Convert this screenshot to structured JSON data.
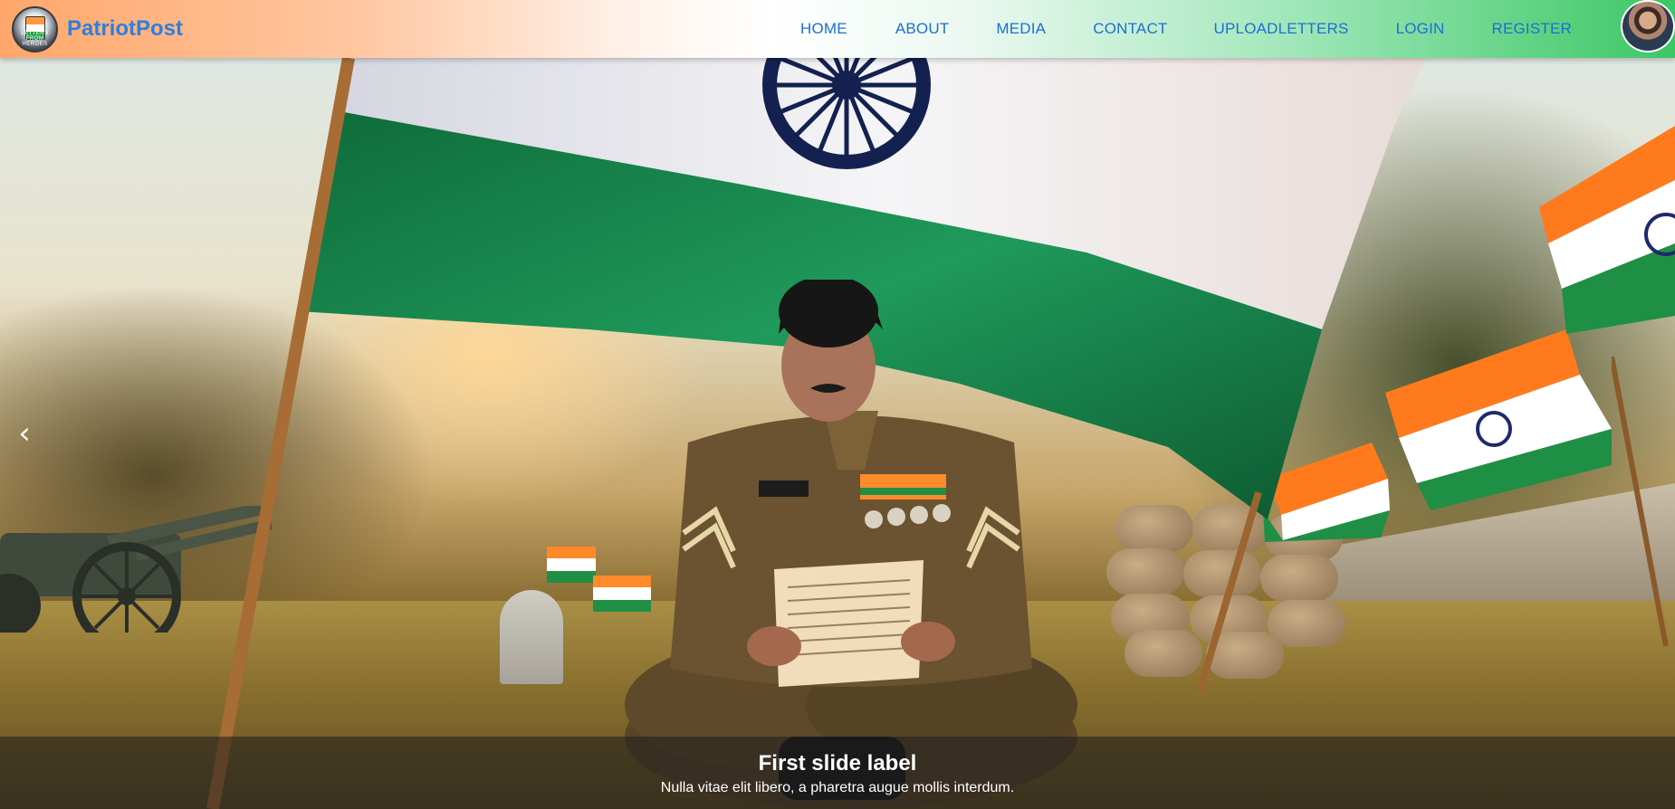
{
  "navbar": {
    "brand": {
      "name": "PatriotPost",
      "logo_icon": "patriotpost-logo",
      "logo_ring_text": "LETTERS FROM HEROES"
    },
    "links": [
      {
        "label": "HOME"
      },
      {
        "label": "ABOUT"
      },
      {
        "label": "MEDIA"
      },
      {
        "label": "CONTACT"
      },
      {
        "label": "UPLOADLETTERS"
      },
      {
        "label": "LOGIN"
      },
      {
        "label": "REGISTER"
      }
    ],
    "avatar_icon": "user-avatar",
    "colors": {
      "gradient_left": "#ffa66b",
      "gradient_mid": "#ffffff",
      "gradient_right": "#3cc765",
      "link_color": "#1b6fd1",
      "brand_color": "#2d7fe0"
    }
  },
  "carousel": {
    "prev_control_icon": "chevron-left-icon",
    "prev_control_glyph": "‹",
    "slide": {
      "image_alt": "Soldier reading a letter beneath the Indian flag",
      "caption_title": "First slide label",
      "caption_text": "Nulla vitae elit libero, a pharetra augue mollis interdum."
    }
  }
}
